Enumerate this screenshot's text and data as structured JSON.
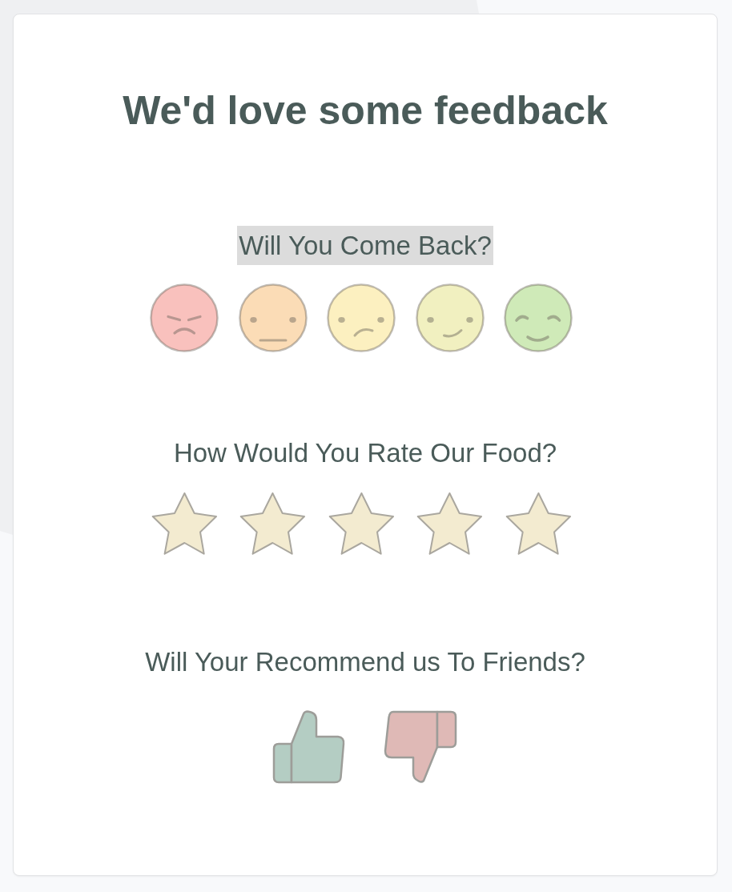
{
  "title": "We'd love some feedback",
  "questions": [
    {
      "kind": "faces",
      "label": "Will You Come Back?",
      "highlighted": true,
      "options": [
        {
          "kind": "angry",
          "color": "#f9c1bd",
          "selected": false
        },
        {
          "kind": "neutral",
          "color": "#fbdcb6",
          "selected": false
        },
        {
          "kind": "frown",
          "color": "#fcf0c0",
          "selected": false
        },
        {
          "kind": "smile",
          "color": "#f1f0c0",
          "selected": false
        },
        {
          "kind": "grin",
          "color": "#cfeab8",
          "selected": false
        }
      ]
    },
    {
      "kind": "stars",
      "label": "How Would You Rate Our Food?",
      "highlighted": false,
      "stars": 5
    },
    {
      "kind": "thumbs",
      "label": "Will Your Recommend us To Friends?",
      "highlighted": false,
      "options": [
        {
          "kind": "up",
          "color": "#b4cdc3",
          "selected": false
        },
        {
          "kind": "down",
          "color": "#dfb9b6",
          "selected": false
        }
      ]
    }
  ]
}
